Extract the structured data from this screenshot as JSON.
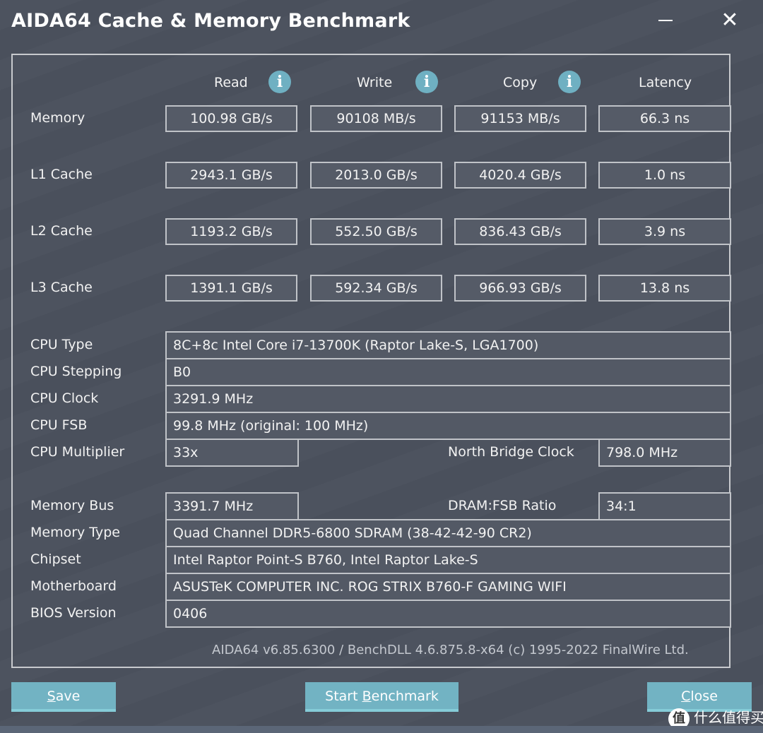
{
  "window": {
    "title": "AIDA64 Cache & Memory Benchmark",
    "minimize_icon": "minimize-icon",
    "close_icon": "close-icon",
    "close_glyph": "✕"
  },
  "columns": {
    "read": "Read",
    "write": "Write",
    "copy": "Copy",
    "latency": "Latency",
    "info_glyph": "i"
  },
  "benchmarks": [
    {
      "label": "Memory",
      "read": "100.98 GB/s",
      "write": "90108 MB/s",
      "copy": "91153 MB/s",
      "latency": "66.3 ns"
    },
    {
      "label": "L1 Cache",
      "read": "2943.1 GB/s",
      "write": "2013.0 GB/s",
      "copy": "4020.4 GB/s",
      "latency": "1.0 ns"
    },
    {
      "label": "L2 Cache",
      "read": "1193.2 GB/s",
      "write": "552.50 GB/s",
      "copy": "836.43 GB/s",
      "latency": "3.9 ns"
    },
    {
      "label": "L3 Cache",
      "read": "1391.1 GB/s",
      "write": "592.34 GB/s",
      "copy": "966.93 GB/s",
      "latency": "13.8 ns"
    }
  ],
  "cpu_info": {
    "cpu_type": {
      "label": "CPU Type",
      "value": "8C+8c Intel Core i7-13700K  (Raptor Lake-S, LGA1700)"
    },
    "cpu_stepping": {
      "label": "CPU Stepping",
      "value": "B0"
    },
    "cpu_clock": {
      "label": "CPU Clock",
      "value": "3291.9 MHz"
    },
    "cpu_fsb": {
      "label": "CPU FSB",
      "value": "99.8 MHz  (original: 100 MHz)"
    },
    "cpu_multiplier": {
      "label": "CPU Multiplier",
      "value": "33x"
    },
    "north_bridge_clock": {
      "label": "North Bridge Clock",
      "value": "798.0 MHz"
    }
  },
  "memory_info": {
    "memory_bus": {
      "label": "Memory Bus",
      "value": "3391.7 MHz"
    },
    "dram_fsb_ratio": {
      "label": "DRAM:FSB Ratio",
      "value": "34:1"
    },
    "memory_type": {
      "label": "Memory Type",
      "value": "Quad Channel DDR5-6800 SDRAM  (38-42-42-90 CR2)"
    },
    "chipset": {
      "label": "Chipset",
      "value": "Intel Raptor Point-S B760, Intel Raptor Lake-S"
    },
    "motherboard": {
      "label": "Motherboard",
      "value": "ASUSTeK COMPUTER INC. ROG STRIX B760-F GAMING WIFI"
    },
    "bios_version": {
      "label": "BIOS Version",
      "value": "0406"
    }
  },
  "footer": {
    "version_text": "AIDA64 v6.85.6300 / BenchDLL 4.6.875.8-x64  (c) 1995-2022 FinalWire Ltd."
  },
  "buttons": {
    "save": {
      "accel": "S",
      "rest": "ave"
    },
    "start_benchmark": {
      "pre": "Start ",
      "accel": "B",
      "rest": "enchmark"
    },
    "close": {
      "accel": "C",
      "rest": "lose"
    }
  },
  "watermark": {
    "badge": "值",
    "text": "什么值得买"
  },
  "colors": {
    "background": "#4b515d",
    "button": "#72b3c3",
    "info_icon": "#6fb0c2",
    "border": "#c0c3c8"
  }
}
